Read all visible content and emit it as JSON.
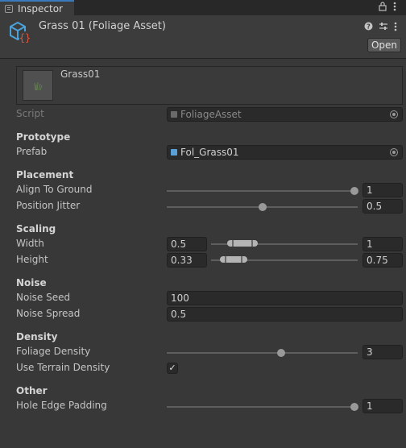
{
  "tab": {
    "label": "Inspector"
  },
  "header": {
    "title": "Grass 01 (Foliage Asset)",
    "open_label": "Open"
  },
  "preview": {
    "name": "Grass01"
  },
  "script": {
    "label": "Script",
    "value": "FoliageAsset"
  },
  "sections": {
    "prototype": "Prototype",
    "placement": "Placement",
    "scaling": "Scaling",
    "noise": "Noise",
    "density": "Density",
    "other": "Other"
  },
  "prefab": {
    "label": "Prefab",
    "value": "Fol_Grass01"
  },
  "align_to_ground": {
    "label": "Align To Ground",
    "value": "1",
    "fraction": 1.0
  },
  "position_jitter": {
    "label": "Position Jitter",
    "value": "0.5",
    "fraction": 0.5
  },
  "width": {
    "label": "Width",
    "min": "0.5",
    "max": "1"
  },
  "height": {
    "label": "Height",
    "min": "0.33",
    "max": "0.75"
  },
  "noise_seed": {
    "label": "Noise Seed",
    "value": "100"
  },
  "noise_spread": {
    "label": "Noise Spread",
    "value": "0.5"
  },
  "foliage_density": {
    "label": "Foliage Density",
    "value": "3",
    "fraction": 0.6
  },
  "use_terrain_density": {
    "label": "Use Terrain Density",
    "checked": true,
    "mark": "✓"
  },
  "hole_edge_padding": {
    "label": "Hole Edge Padding",
    "value": "1",
    "fraction": 1.0
  },
  "colors": {
    "accent": "#3a79bb",
    "asset_icon": "#4aa3d8",
    "asset_braces": "#e0553f"
  }
}
